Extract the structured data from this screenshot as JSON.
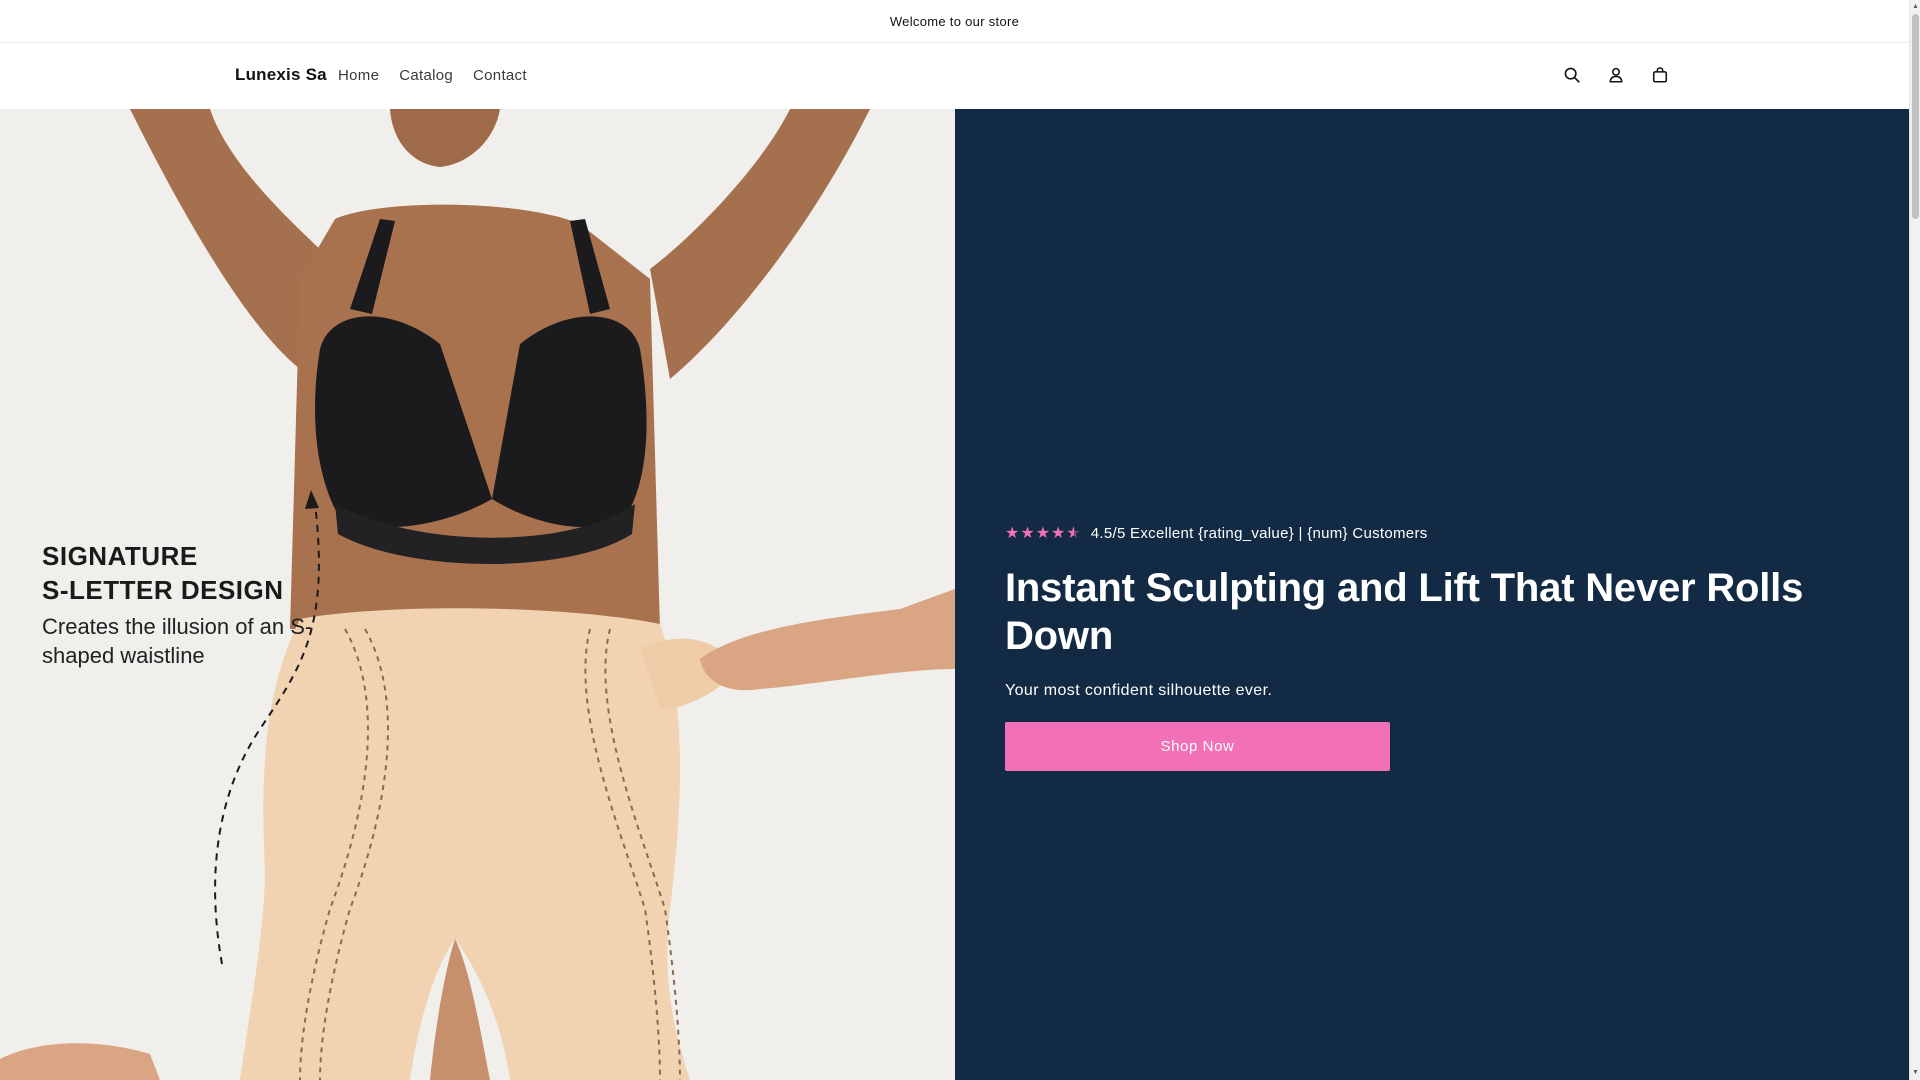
{
  "announcement": {
    "text": "Welcome to our store"
  },
  "header": {
    "logo": "Lunexis Sa",
    "nav": [
      {
        "label": "Home"
      },
      {
        "label": "Catalog"
      },
      {
        "label": "Contact"
      }
    ],
    "icons": [
      "search-icon",
      "account-icon",
      "cart-icon"
    ]
  },
  "hero": {
    "image": {
      "title_line1": "SIGNATURE",
      "title_line2": "S-LETTER DESIGN",
      "subtitle": "Creates the illusion of an S-shaped waistline"
    },
    "rating": {
      "stars": 4.5,
      "text": "4.5/5 Excellent {rating_value} | {num} Customers"
    },
    "headline": "Instant Sculpting and Lift That Never Rolls Down",
    "subheadline": "Your most confident silhouette ever.",
    "cta_label": "Shop Now"
  },
  "colors": {
    "hero_panel": "#122a43",
    "accent_pink": "#f270b5",
    "image_background": "#f1efec",
    "garment_nude": "#f1d2b1",
    "text_dark": "#121212"
  }
}
